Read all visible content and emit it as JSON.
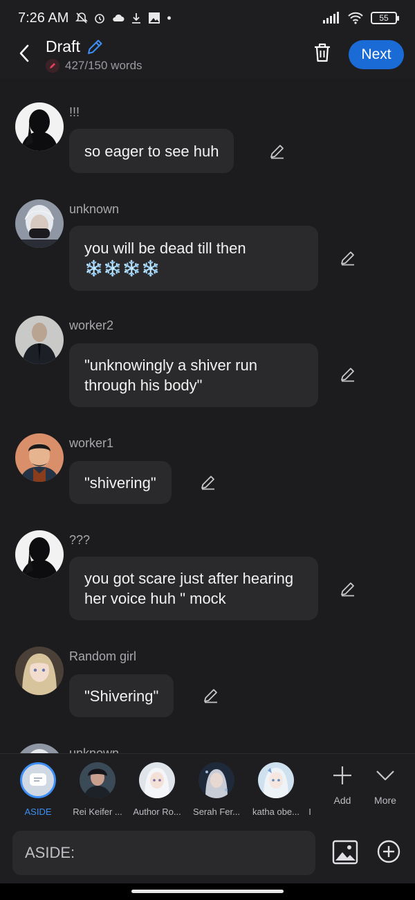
{
  "status_bar": {
    "time": "7:26 AM",
    "battery": "55"
  },
  "header": {
    "title": "Draft",
    "word_count": "427/150 words",
    "next_label": "Next"
  },
  "messages": [
    {
      "name": "!!!",
      "text": "so eager to see huh",
      "avatar": "silhouette"
    },
    {
      "name": "unknown",
      "text": "you will be dead till then ❄️❄️❄️❄️",
      "avatar": "masked-white-hair"
    },
    {
      "name": "worker2",
      "text": "\"unknowingly a shiver run through his body\"",
      "avatar": "bald-man"
    },
    {
      "name": "worker1",
      "text": "\"shivering\"",
      "avatar": "dark-hair-man"
    },
    {
      "name": "???",
      "text": "you got scare just after hearing her voice huh \" mock",
      "avatar": "silhouette"
    },
    {
      "name": "Random girl",
      "text": "\"Shivering\"",
      "avatar": "blonde-girl"
    },
    {
      "name": "unknown",
      "text": "",
      "avatar": "masked-white-hair"
    }
  ],
  "characters": [
    {
      "label": "ASIDE",
      "active": true
    },
    {
      "label": "Rei Keifer ..."
    },
    {
      "label": "Author Ro..."
    },
    {
      "label": "Serah Fer..."
    },
    {
      "label": "katha obe..."
    },
    {
      "label": "I"
    }
  ],
  "tools": {
    "add_label": "Add",
    "more_label": "More"
  },
  "input": {
    "placeholder": "ASIDE:"
  },
  "colors": {
    "background": "#1c1c1e",
    "bubble": "#2a2a2c",
    "accent": "#1a6bd6",
    "active_label": "#3d8ef5"
  }
}
